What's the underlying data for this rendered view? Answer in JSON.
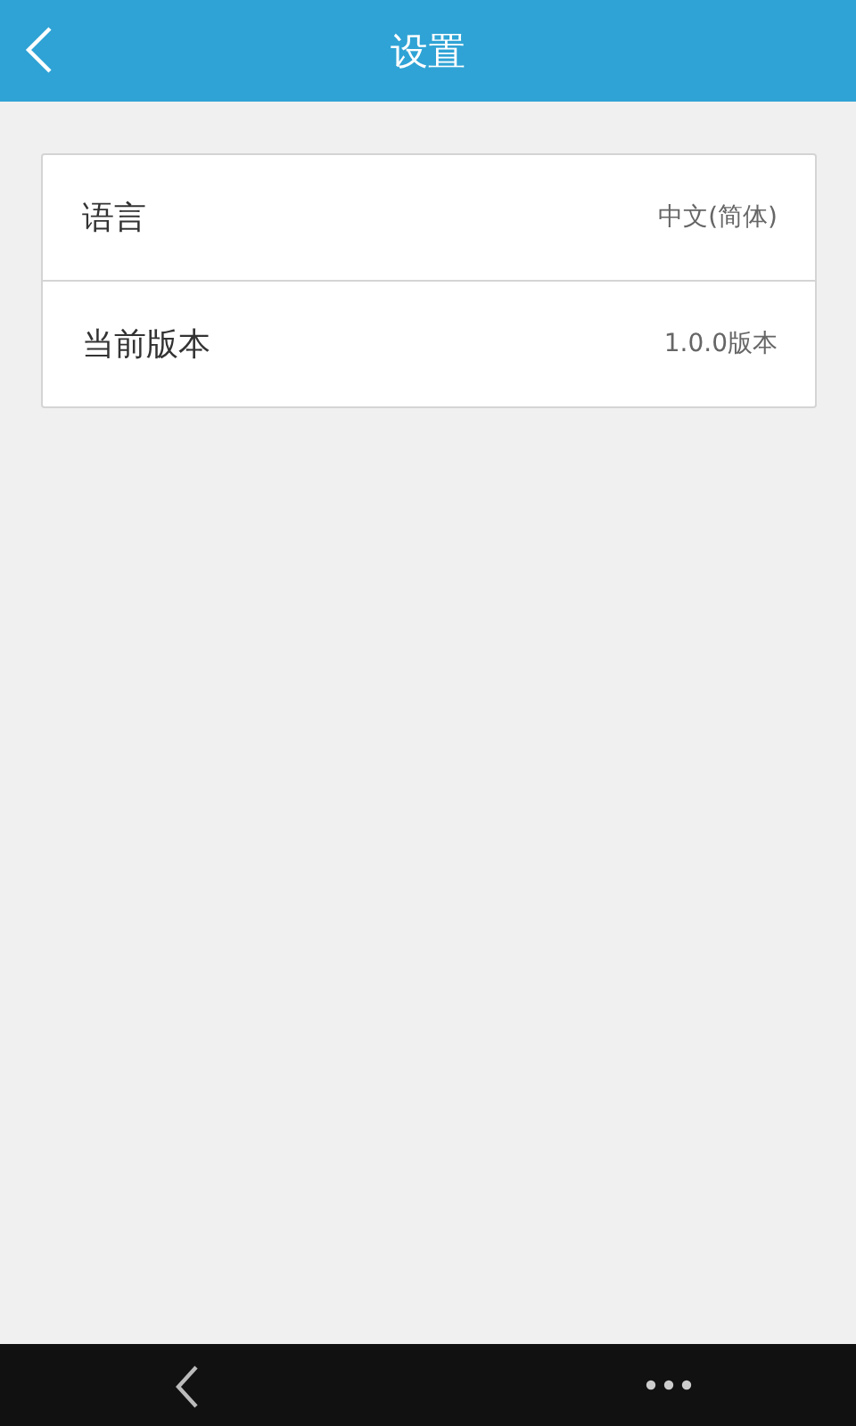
{
  "header": {
    "title": "设置"
  },
  "settings": [
    {
      "label": "语言",
      "value": "中文(简体)"
    },
    {
      "label": "当前版本",
      "value": "1.0.0版本"
    }
  ]
}
